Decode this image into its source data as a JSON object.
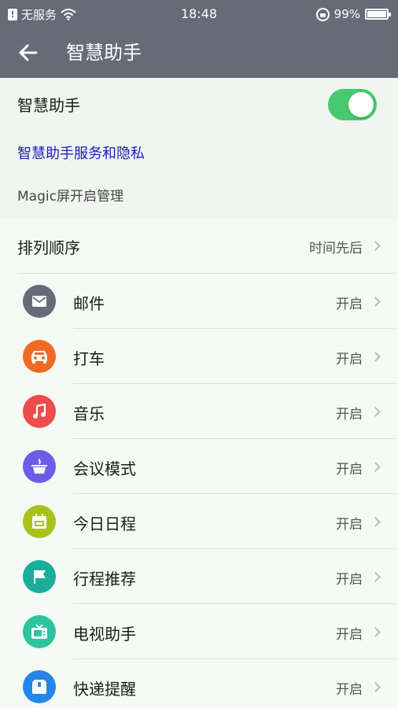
{
  "status_bar": {
    "carrier": "无服务",
    "time": "18:48",
    "battery_percent": "99%",
    "battery_level": 0.99
  },
  "header": {
    "title": "智慧助手"
  },
  "assistant": {
    "label": "智慧助手",
    "enabled": true,
    "privacy_link": "智慧助手服务和隐私",
    "magic_screen_label": "Magic屏开启管理"
  },
  "sort": {
    "label": "排列顺序",
    "value": "时间先后"
  },
  "features": [
    {
      "label": "邮件",
      "status": "开启",
      "icon": "mail-icon",
      "color": "#666b78"
    },
    {
      "label": "打车",
      "status": "开启",
      "icon": "car-icon",
      "color": "#f06a26"
    },
    {
      "label": "音乐",
      "status": "开启",
      "icon": "music-icon",
      "color": "#ee4b4c"
    },
    {
      "label": "会议模式",
      "status": "开启",
      "icon": "meeting-icon",
      "color": "#6e5ce6"
    },
    {
      "label": "今日日程",
      "status": "开启",
      "icon": "calendar-icon",
      "color": "#a9c21a"
    },
    {
      "label": "行程推荐",
      "status": "开启",
      "icon": "flag-icon",
      "color": "#19ad9a"
    },
    {
      "label": "电视助手",
      "status": "开启",
      "icon": "tv-icon",
      "color": "#2dc4a0"
    },
    {
      "label": "快递提醒",
      "status": "开启",
      "icon": "package-icon",
      "color": "#2486eb"
    }
  ],
  "colors": {
    "header_bg": "#666b78",
    "toggle_on": "#47c96d",
    "link": "#1a21b8"
  }
}
